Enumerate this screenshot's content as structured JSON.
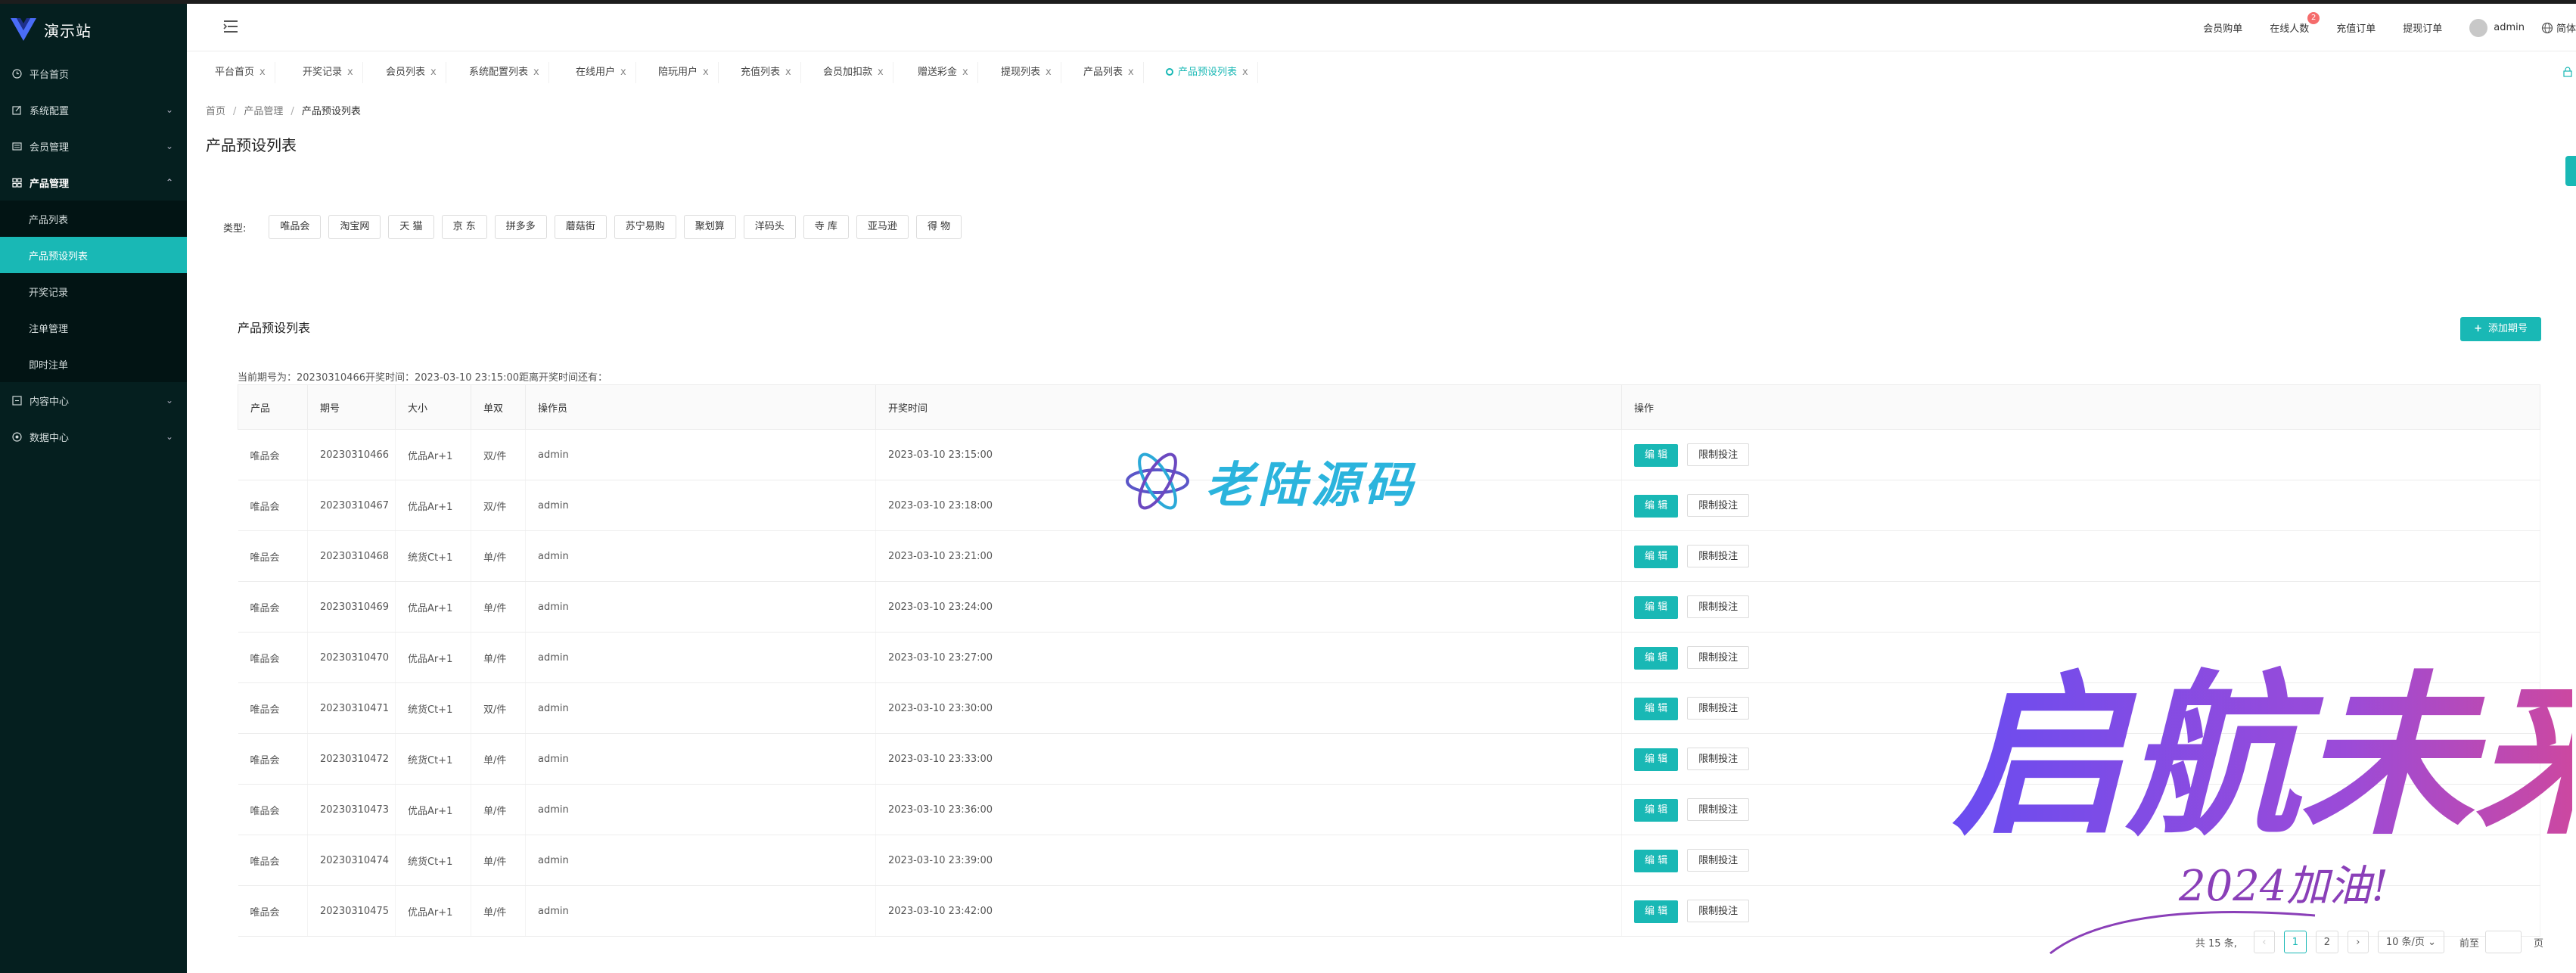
{
  "sidebar": {
    "logo_text": "演示站",
    "items": [
      {
        "label": "平台首页",
        "icon": "clock-icon"
      },
      {
        "label": "系统配置",
        "icon": "edit-icon"
      },
      {
        "label": "会员管理",
        "icon": "list-icon"
      },
      {
        "label": "产品管理",
        "icon": "grid-icon"
      },
      {
        "label": "内容中心",
        "icon": "document-icon"
      },
      {
        "label": "数据中心",
        "icon": "target-icon"
      }
    ],
    "sub_items": [
      "产品列表",
      "产品预设列表",
      "开奖记录",
      "注单管理",
      "即时注单"
    ]
  },
  "header": {
    "links": [
      "会员购单",
      "在线人数",
      "充值订单",
      "提现订单"
    ],
    "online_badge": "2",
    "username": "admin",
    "lang": "简体"
  },
  "tabs": [
    "平台首页",
    "开奖记录",
    "会员列表",
    "系统配置列表",
    "在线用户",
    "陪玩用户",
    "充值列表",
    "会员加扣款",
    "赠送彩金",
    "提现列表",
    "产品列表",
    "产品预设列表"
  ],
  "tab_close": "x",
  "breadcrumb": {
    "home": "首页",
    "section": "产品管理",
    "current": "产品预设列表"
  },
  "page_title": "产品预设列表",
  "filter": {
    "label": "类型:",
    "chips": [
      "唯品会",
      "淘宝网",
      "天 猫",
      "京 东",
      "拼多多",
      "蘑菇街",
      "苏宁易购",
      "聚划算",
      "洋码头",
      "寺 库",
      "亚马逊",
      "得 物"
    ]
  },
  "card": {
    "title": "产品预设列表",
    "add_button": "添加期号",
    "period_info": "当前期号为：20230310466开奖时间：2023-03-10 23:15:00距离开奖时间还有："
  },
  "table": {
    "headers": [
      "产品",
      "期号",
      "大小",
      "单双",
      "操作员",
      "开奖时间",
      "操作"
    ],
    "rows": [
      [
        "唯品会",
        "20230310466",
        "优品Ar+1",
        "双/件",
        "admin",
        "2023-03-10 23:15:00"
      ],
      [
        "唯品会",
        "20230310467",
        "优品Ar+1",
        "双/件",
        "admin",
        "2023-03-10 23:18:00"
      ],
      [
        "唯品会",
        "20230310468",
        "统货Ct+1",
        "单/件",
        "admin",
        "2023-03-10 23:21:00"
      ],
      [
        "唯品会",
        "20230310469",
        "优品Ar+1",
        "单/件",
        "admin",
        "2023-03-10 23:24:00"
      ],
      [
        "唯品会",
        "20230310470",
        "优品Ar+1",
        "单/件",
        "admin",
        "2023-03-10 23:27:00"
      ],
      [
        "唯品会",
        "20230310471",
        "统货Ct+1",
        "双/件",
        "admin",
        "2023-03-10 23:30:00"
      ],
      [
        "唯品会",
        "20230310472",
        "统货Ct+1",
        "单/件",
        "admin",
        "2023-03-10 23:33:00"
      ],
      [
        "唯品会",
        "20230310473",
        "优品Ar+1",
        "单/件",
        "admin",
        "2023-03-10 23:36:00"
      ],
      [
        "唯品会",
        "20230310474",
        "统货Ct+1",
        "单/件",
        "admin",
        "2023-03-10 23:39:00"
      ],
      [
        "唯品会",
        "20230310475",
        "优品Ar+1",
        "单/件",
        "admin",
        "2023-03-10 23:42:00"
      ]
    ],
    "edit_label": "编 辑",
    "limit_label": "限制投注"
  },
  "pager": {
    "total": "共 15 条,",
    "pages": [
      "1",
      "2"
    ],
    "active_page": "1",
    "page_size": "10 条/页",
    "jump_label": "前至",
    "page_unit": "页"
  },
  "watermark": {
    "site": "老陆源码",
    "slogan": "启航未来",
    "slogan_sub": "2024加油!"
  },
  "colors": {
    "accent": "#19b8b5",
    "sidebar_bg": "#051f1f",
    "badge": "#f56c6c"
  }
}
